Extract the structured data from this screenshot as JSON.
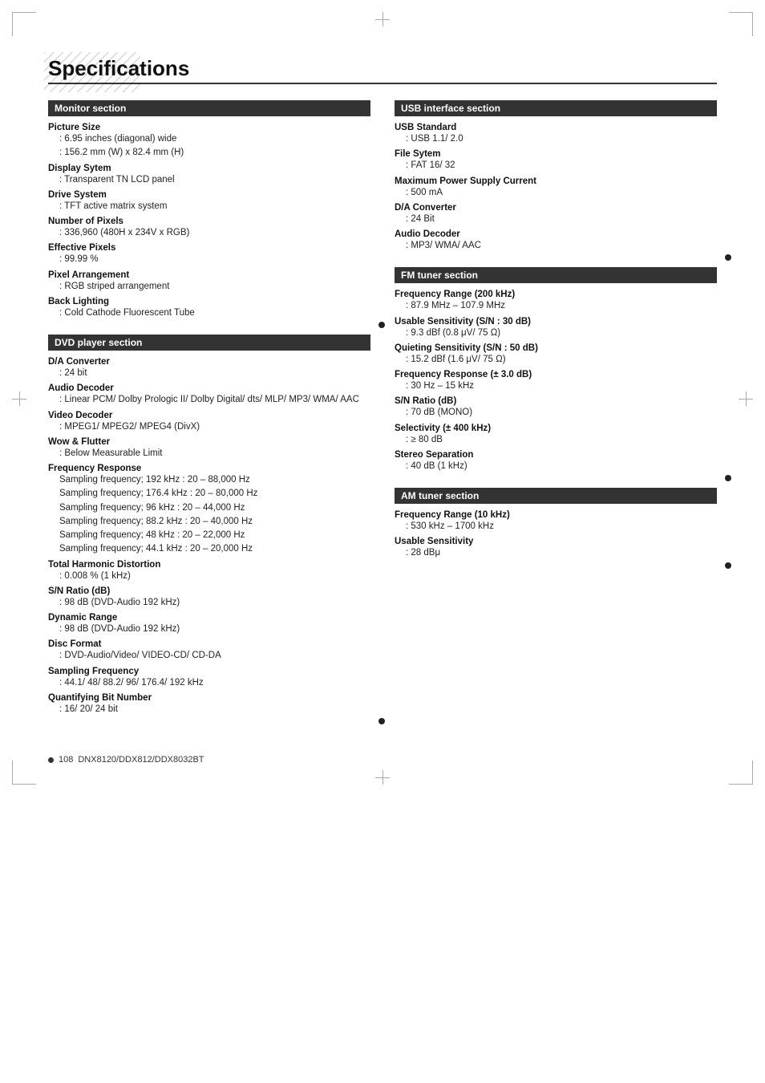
{
  "page": {
    "title": "Specifications",
    "footer_text": "108",
    "footer_model": "DNX8120/DDX812/DDX8032BT"
  },
  "monitor_section": {
    "header": "Monitor section",
    "items": [
      {
        "label": "Picture Size",
        "values": [
          ": 6.95 inches (diagonal) wide",
          ": 156.2 mm (W) x 82.4 mm (H)"
        ]
      },
      {
        "label": "Display Sytem",
        "values": [
          ": Transparent TN LCD panel"
        ]
      },
      {
        "label": "Drive System",
        "values": [
          ": TFT active matrix system"
        ]
      },
      {
        "label": "Number of Pixels",
        "values": [
          ": 336,960 (480H x 234V x RGB)"
        ]
      },
      {
        "label": "Effective Pixels",
        "values": [
          ": 99.99 %"
        ]
      },
      {
        "label": "Pixel Arrangement",
        "values": [
          ": RGB striped arrangement"
        ]
      },
      {
        "label": "Back Lighting",
        "values": [
          ": Cold Cathode Fluorescent Tube"
        ]
      }
    ]
  },
  "dvd_section": {
    "header": "DVD player section",
    "items": [
      {
        "label": "D/A Converter",
        "values": [
          ": 24 bit"
        ]
      },
      {
        "label": "Audio Decoder",
        "values": [
          ": Linear PCM/ Dolby Prologic II/ Dolby Digital/ dts/ MLP/ MP3/ WMA/ AAC"
        ]
      },
      {
        "label": "Video Decoder",
        "values": [
          ": MPEG1/ MPEG2/ MPEG4 (DivX)"
        ]
      },
      {
        "label": "Wow & Flutter",
        "values": [
          ": Below Measurable Limit"
        ]
      },
      {
        "label": "Frequency Response",
        "values": [
          "Sampling frequency; 192 kHz : 20 – 88,000 Hz",
          "Sampling frequency; 176.4 kHz : 20 – 80,000 Hz",
          "Sampling frequency; 96 kHz : 20 – 44,000 Hz",
          "Sampling frequency; 88.2 kHz : 20 – 40,000 Hz",
          "Sampling frequency; 48 kHz : 20 – 22,000 Hz",
          "Sampling frequency; 44.1 kHz : 20 – 20,000 Hz"
        ]
      },
      {
        "label": "Total Harmonic Distortion",
        "values": [
          ": 0.008 % (1 kHz)"
        ]
      },
      {
        "label": "S/N Ratio (dB)",
        "values": [
          ": 98 dB (DVD-Audio 192 kHz)"
        ]
      },
      {
        "label": "Dynamic Range",
        "values": [
          ": 98 dB (DVD-Audio 192 kHz)"
        ]
      },
      {
        "label": "Disc Format",
        "values": [
          ": DVD-Audio/Video/ VIDEO-CD/ CD-DA"
        ]
      },
      {
        "label": "Sampling Frequency",
        "values": [
          ": 44.1/ 48/ 88.2/ 96/ 176.4/ 192 kHz"
        ]
      },
      {
        "label": "Quantifying Bit Number",
        "values": [
          ": 16/ 20/ 24 bit"
        ]
      }
    ]
  },
  "usb_section": {
    "header": "USB interface section",
    "items": [
      {
        "label": "USB Standard",
        "values": [
          ": USB 1.1/ 2.0"
        ]
      },
      {
        "label": "File Sytem",
        "values": [
          ": FAT 16/ 32"
        ]
      },
      {
        "label": "Maximum Power Supply Current",
        "values": [
          ": 500 mA"
        ]
      },
      {
        "label": "D/A Converter",
        "values": [
          ": 24 Bit"
        ]
      },
      {
        "label": "Audio Decoder",
        "values": [
          ": MP3/ WMA/ AAC"
        ]
      }
    ]
  },
  "fm_section": {
    "header": "FM tuner section",
    "items": [
      {
        "label": "Frequency Range (200 kHz)",
        "values": [
          ": 87.9 MHz – 107.9 MHz"
        ]
      },
      {
        "label": "Usable Sensitivity (S/N : 30 dB)",
        "values": [
          ": 9.3 dBf (0.8 μV/ 75 Ω)"
        ]
      },
      {
        "label": "Quieting Sensitivity (S/N : 50 dB)",
        "values": [
          ": 15.2 dBf (1.6 μV/ 75 Ω)"
        ]
      },
      {
        "label": "Frequency Response (± 3.0 dB)",
        "values": [
          ": 30 Hz – 15 kHz"
        ]
      },
      {
        "label": "S/N Ratio (dB)",
        "values": [
          ": 70 dB (MONO)"
        ]
      },
      {
        "label": "Selectivity (± 400 kHz)",
        "values": [
          ": ≥ 80 dB"
        ]
      },
      {
        "label": "Stereo Separation",
        "values": [
          ": 40 dB (1 kHz)"
        ]
      }
    ]
  },
  "am_section": {
    "header": "AM tuner section",
    "items": [
      {
        "label": "Frequency Range (10 kHz)",
        "values": [
          ": 530 kHz – 1700 kHz"
        ]
      },
      {
        "label": "Usable Sensitivity",
        "values": [
          ": 28 dBμ"
        ]
      }
    ]
  }
}
